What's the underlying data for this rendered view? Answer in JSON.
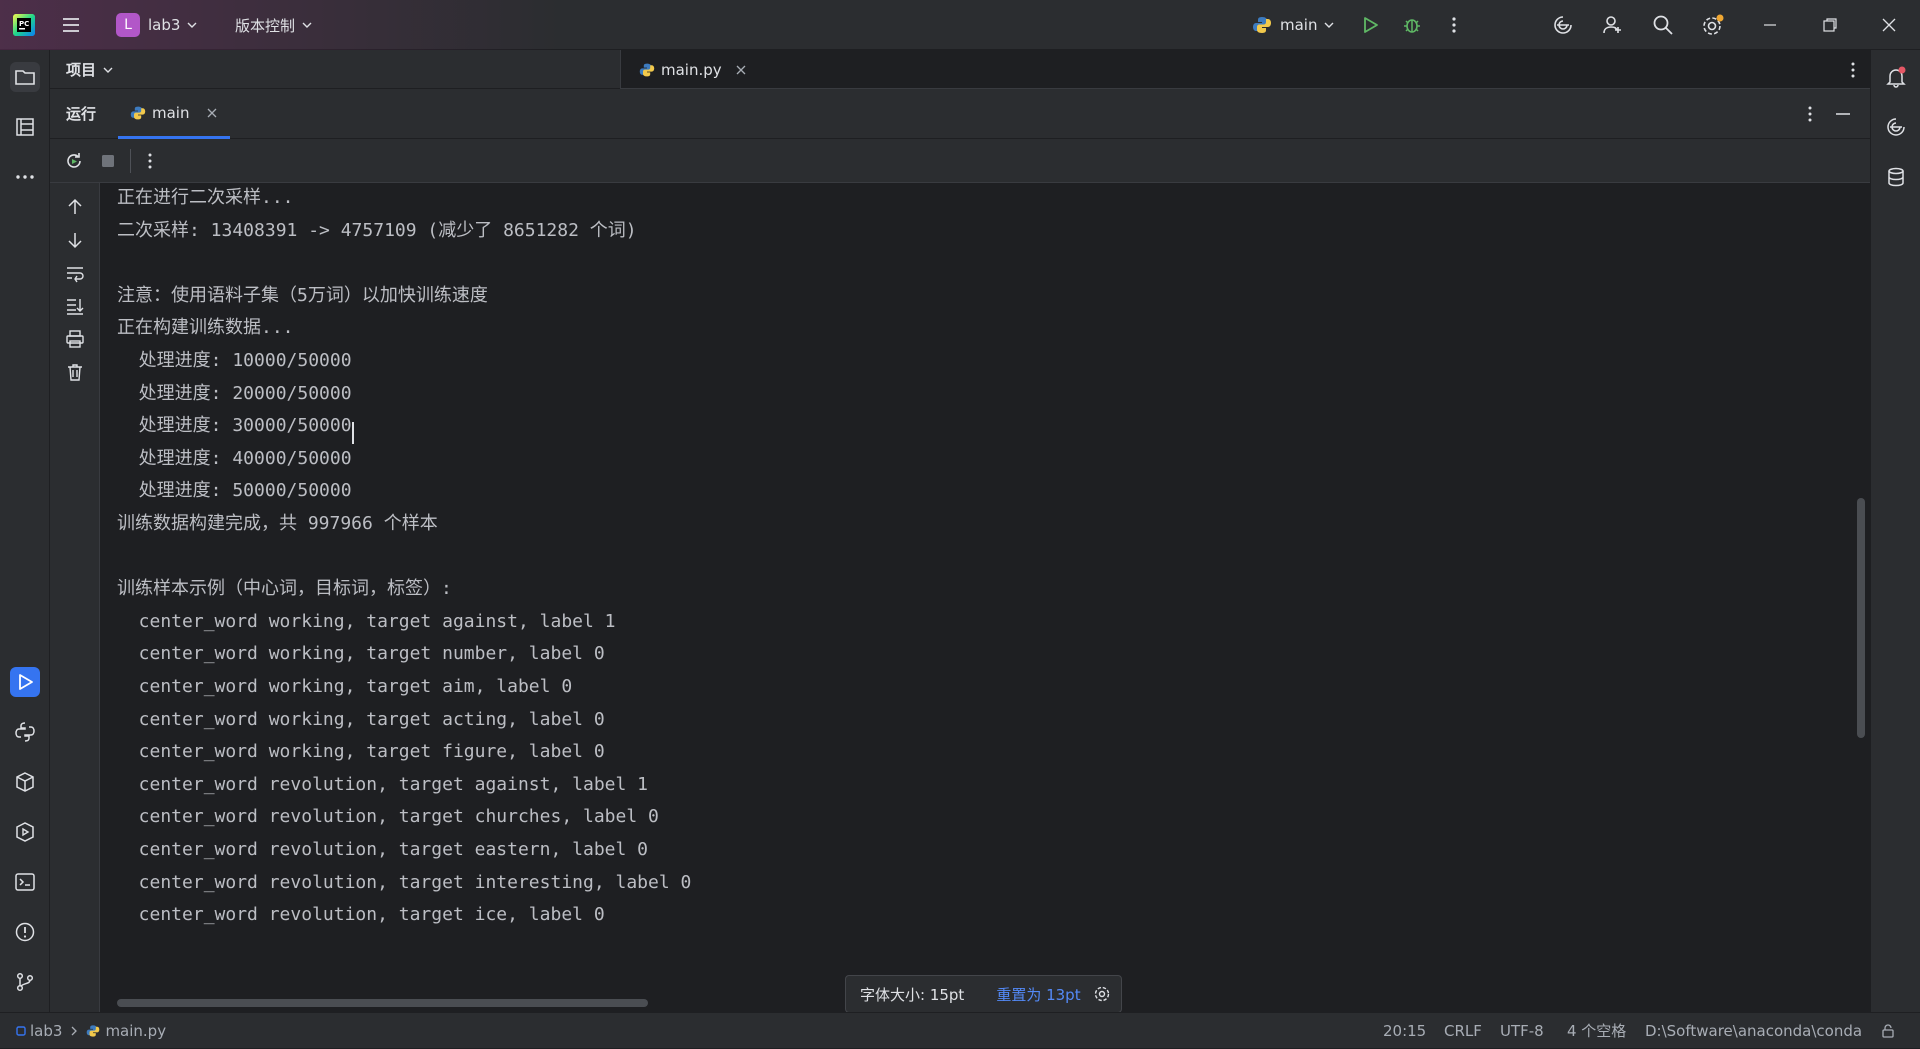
{
  "titlebar": {
    "project_initial": "L",
    "project_name": "lab3",
    "vcs_label": "版本控制",
    "run_config": "main"
  },
  "project_panel": {
    "title": "项目"
  },
  "editor_tabs": [
    {
      "label": "main.py"
    }
  ],
  "run_panel": {
    "title": "运行",
    "tab_label": "main"
  },
  "console": {
    "lines": [
      "正在进行二次采样...",
      "二次采样: 13408391 -> 4757109 (减少了 8651282 个词)",
      "",
      "注意：使用语料子集（5万词）以加快训练速度",
      "正在构建训练数据...",
      "  处理进度: 10000/50000",
      "  处理进度: 20000/50000",
      "  处理进度: 30000/50000",
      "  处理进度: 40000/50000",
      "  处理进度: 50000/50000",
      "训练数据构建完成，共 997966 个样本",
      "",
      "训练样本示例（中心词，目标词，标签）:",
      "  center_word working, target against, label 1",
      "  center_word working, target number, label 0",
      "  center_word working, target aim, label 0",
      "  center_word working, target acting, label 0",
      "  center_word working, target figure, label 0",
      "  center_word revolution, target against, label 1",
      "  center_word revolution, target churches, label 0",
      "  center_word revolution, target eastern, label 0",
      "  center_word revolution, target interesting, label 0",
      "  center_word revolution, target ice, label 0"
    ]
  },
  "font_popup": {
    "size_label": "字体大小: 15pt",
    "reset_label": "重置为 13pt"
  },
  "statusbar": {
    "project": "lab3",
    "file": "main.py",
    "position": "20:15",
    "line_sep": "CRLF",
    "encoding": "UTF-8",
    "indent": "4 个空格",
    "interpreter": "D:\\Software\\anaconda\\conda"
  },
  "colors": {
    "accent": "#3574f0",
    "run_green": "#5fb865",
    "project_badge": "#b257c8",
    "link": "#548af7"
  }
}
